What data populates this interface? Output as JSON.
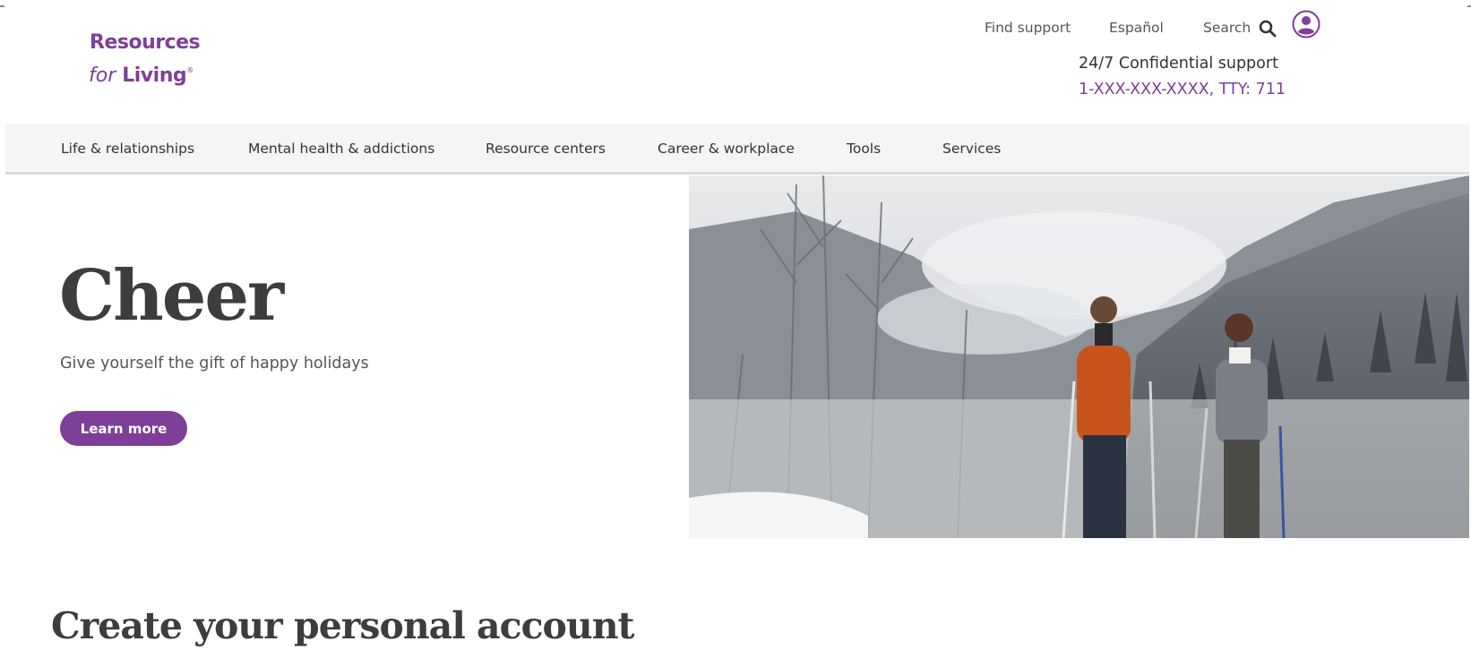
{
  "logo": {
    "line1": "Resources",
    "line2_italic": "for",
    "line2_bold": "Living",
    "mark": "®"
  },
  "utility_nav": {
    "find_support": "Find support",
    "espanol": "Español",
    "search": "Search",
    "search_icon": "search-icon",
    "account_icon": "user-avatar-icon"
  },
  "support": {
    "label": "24/7 Confidential support",
    "phone": "1-XXX-XXX-XXXX, TTY: 711"
  },
  "main_nav": {
    "items": [
      {
        "label": "Life & relationships"
      },
      {
        "label": "Mental health & addictions"
      },
      {
        "label": "Resource centers"
      },
      {
        "label": "Career & workplace"
      },
      {
        "label": "Tools"
      },
      {
        "label": "Services"
      }
    ]
  },
  "hero": {
    "title": "Cheer",
    "subtitle": "Give yourself the gift of happy holidays",
    "button_label": "Learn more",
    "image": "snowy-forest-skiers-photo"
  },
  "section": {
    "title": "Create your personal account"
  },
  "colors": {
    "brand": "#7d3f98",
    "text": "#333333",
    "nav_bg": "#f5f5f5"
  }
}
